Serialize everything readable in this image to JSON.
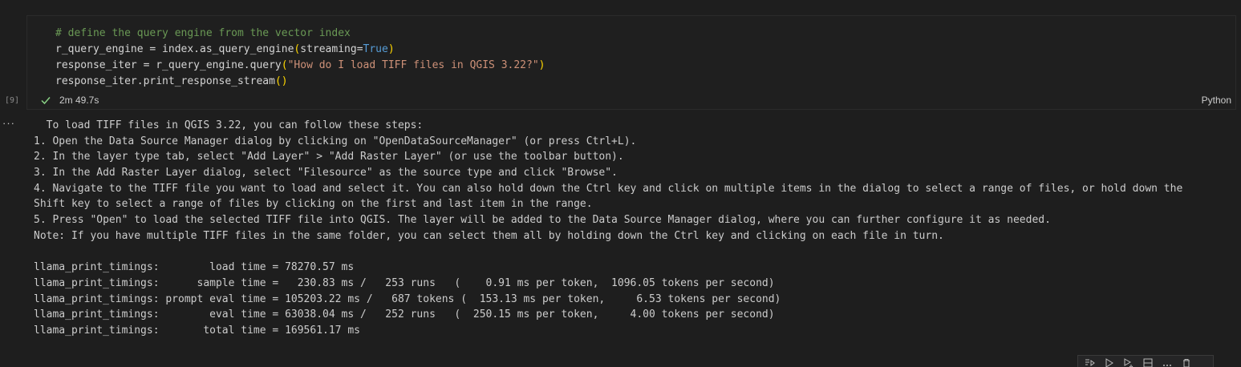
{
  "cell": {
    "execution_count": "[9]",
    "status_duration": "2m 49.7s",
    "language": "Python",
    "code_lines": [
      {
        "comment": "# define the query engine from the vector index"
      },
      {
        "a": "r_query_engine = index.as_query_engine",
        "p1": "(",
        "b": "streaming=",
        "kw": "True",
        "p2": ")"
      },
      {
        "a": "response_iter = r_query_engine.query",
        "p1": "(",
        "s": "\"How do I load TIFF files in QGIS 3.22?\"",
        "p2": ")"
      },
      {
        "a": "response_iter.print_response_stream",
        "p1": "(",
        "p2": ")"
      }
    ]
  },
  "output": {
    "lines": [
      "  To load TIFF files in QGIS 3.22, you can follow these steps:",
      "1. Open the Data Source Manager dialog by clicking on \"OpenDataSourceManager\" (or press Ctrl+L).",
      "2. In the layer type tab, select \"Add Layer\" > \"Add Raster Layer\" (or use the toolbar button).",
      "3. In the Add Raster Layer dialog, select \"Filesource\" as the source type and click \"Browse\".",
      "4. Navigate to the TIFF file you want to load and select it. You can also hold down the Ctrl key and click on multiple items in the dialog to select a range of files, or hold down the",
      "Shift key to select a range of files by clicking on the first and last item in the range.",
      "5. Press \"Open\" to load the selected TIFF file into QGIS. The layer will be added to the Data Source Manager dialog, where you can further configure it as needed.",
      "Note: If you have multiple TIFF files in the same folder, you can select them all by holding down the Ctrl key and clicking on each file in turn.",
      "",
      "llama_print_timings:        load time = 78270.57 ms",
      "llama_print_timings:      sample time =   230.83 ms /   253 runs   (    0.91 ms per token,  1096.05 tokens per second)",
      "llama_print_timings: prompt eval time = 105203.22 ms /   687 tokens (  153.13 ms per token,     6.53 tokens per second)",
      "llama_print_timings:        eval time = 63038.04 ms /   252 runs   (  250.15 ms per token,     4.00 tokens per second)",
      "llama_print_timings:       total time = 169561.17 ms"
    ]
  },
  "icons": {
    "status": "check-icon",
    "more": "more-icon",
    "toolbar": [
      "execute-above-icon",
      "run-cell-icon",
      "run-below-icon",
      "split-cell-icon",
      "more-actions-icon",
      "delete-icon"
    ]
  },
  "colors": {
    "background": "#1e1e1e",
    "success": "#89d185",
    "comment": "#6a9955",
    "string": "#ce9178",
    "keyword": "#569cd6",
    "bracket": "#ffd700"
  }
}
